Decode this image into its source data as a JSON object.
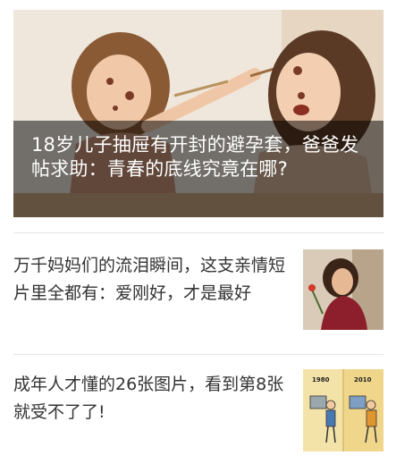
{
  "hero": {
    "title": "18岁儿子抽屉有开封的避孕套，爸爸发帖求助：青春的底线究竟在哪?",
    "image": "two-girls-painting-faces-photo"
  },
  "articles": [
    {
      "title": "万千妈妈们的流泪瞬间，这支亲情短片里全都有：爱刚好，才是最好",
      "thumbnail": "woman-holding-flower-photo"
    },
    {
      "title": "成年人才懂的26张图片，看到第8张就受不了了!",
      "thumbnail": "cartoon-computer-comparison",
      "thumbnail_labels": [
        "1980",
        "2010"
      ]
    }
  ],
  "colors": {
    "title_text": "#333333",
    "overlay": "#000000",
    "divider": "#e6e6e6"
  }
}
